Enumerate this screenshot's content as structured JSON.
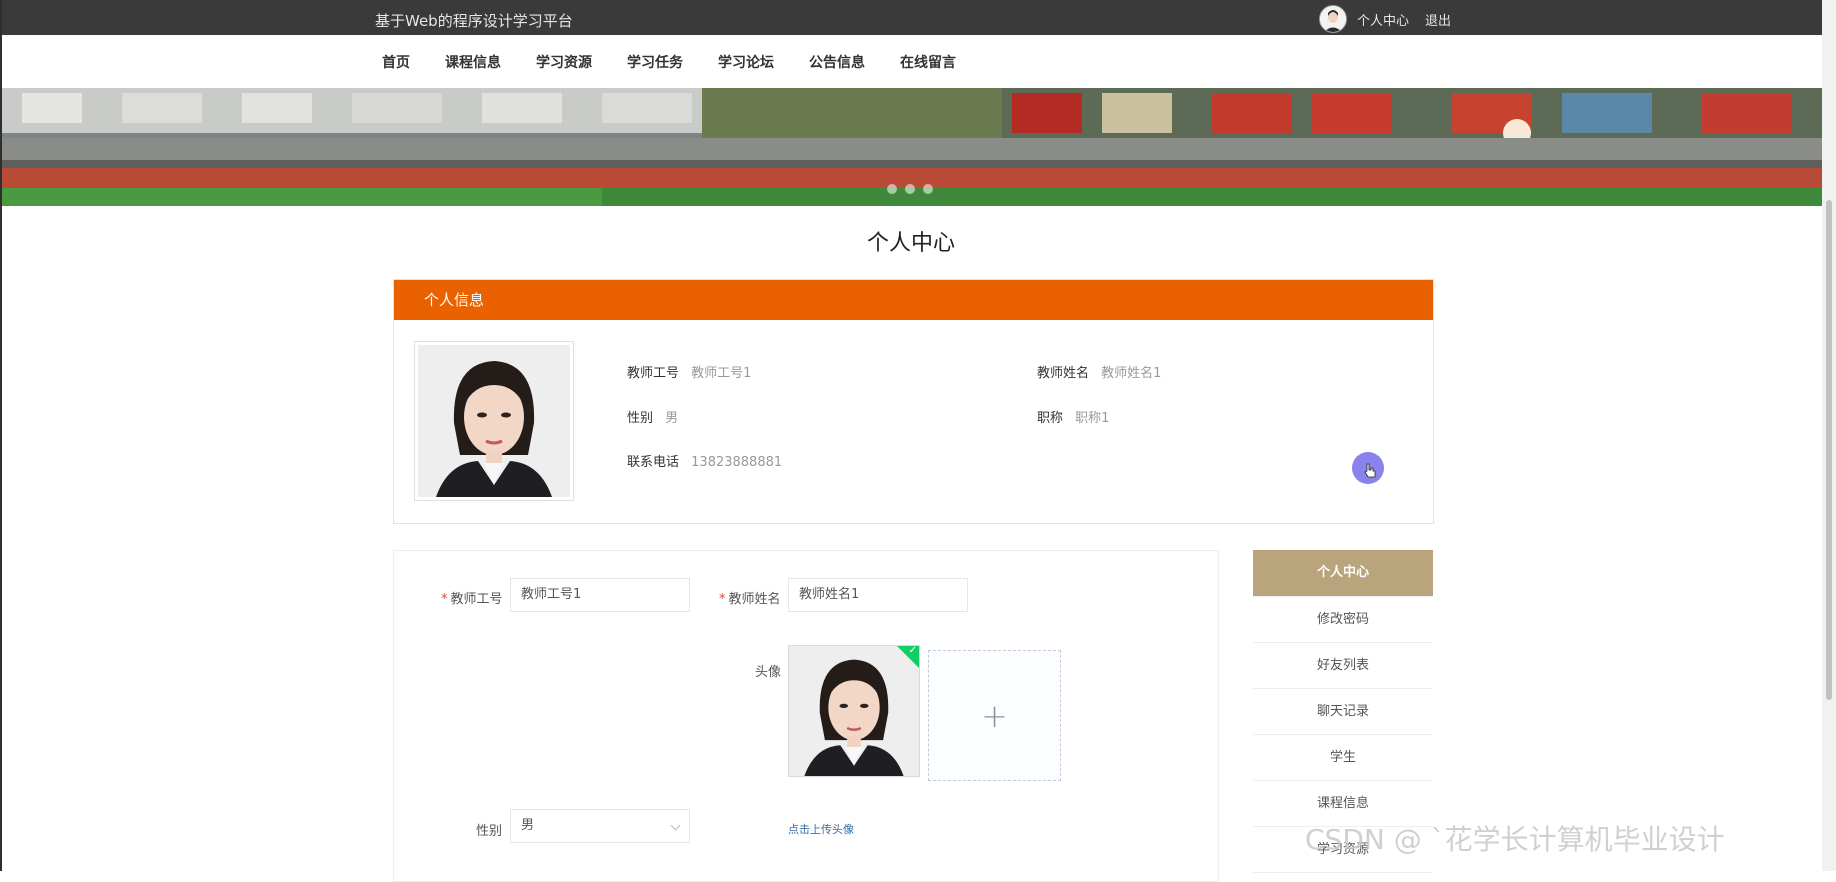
{
  "header": {
    "site_title": "基于Web的程序设计学习平台",
    "personal_center": "个人中心",
    "logout": "退出"
  },
  "nav": {
    "items": [
      "首页",
      "课程信息",
      "学习资源",
      "学习任务",
      "学习论坛",
      "公告信息",
      "在线留言"
    ]
  },
  "page": {
    "title": "个人中心"
  },
  "info_card": {
    "heading": "个人信息",
    "fields": [
      {
        "label": "教师工号",
        "value": "教师工号1"
      },
      {
        "label": "教师姓名",
        "value": "教师姓名1"
      },
      {
        "label": "性别",
        "value": "男"
      },
      {
        "label": "职称",
        "value": "职称1"
      },
      {
        "label": "联系电话",
        "value": "13823888881"
      }
    ]
  },
  "form": {
    "teacher_id_label": "教师工号",
    "teacher_id_value": "教师工号1",
    "teacher_name_label": "教师姓名",
    "teacher_name_value": "教师姓名1",
    "avatar_label": "头像",
    "upload_tip": "点击上传头像",
    "gender_label": "性别",
    "gender_value": "男",
    "check": "✓",
    "plus": "+"
  },
  "side_menu": {
    "items": [
      "个人中心",
      "修改密码",
      "好友列表",
      "聊天记录",
      "学生",
      "课程信息",
      "学习资源"
    ]
  },
  "watermark": "CSDN @ `花学长计算机毕业设计",
  "colors": {
    "topbar": "#3a3a3a",
    "info_header": "#ea6100",
    "side_active": "#b9a47b",
    "cursor": "#7b74e8"
  }
}
